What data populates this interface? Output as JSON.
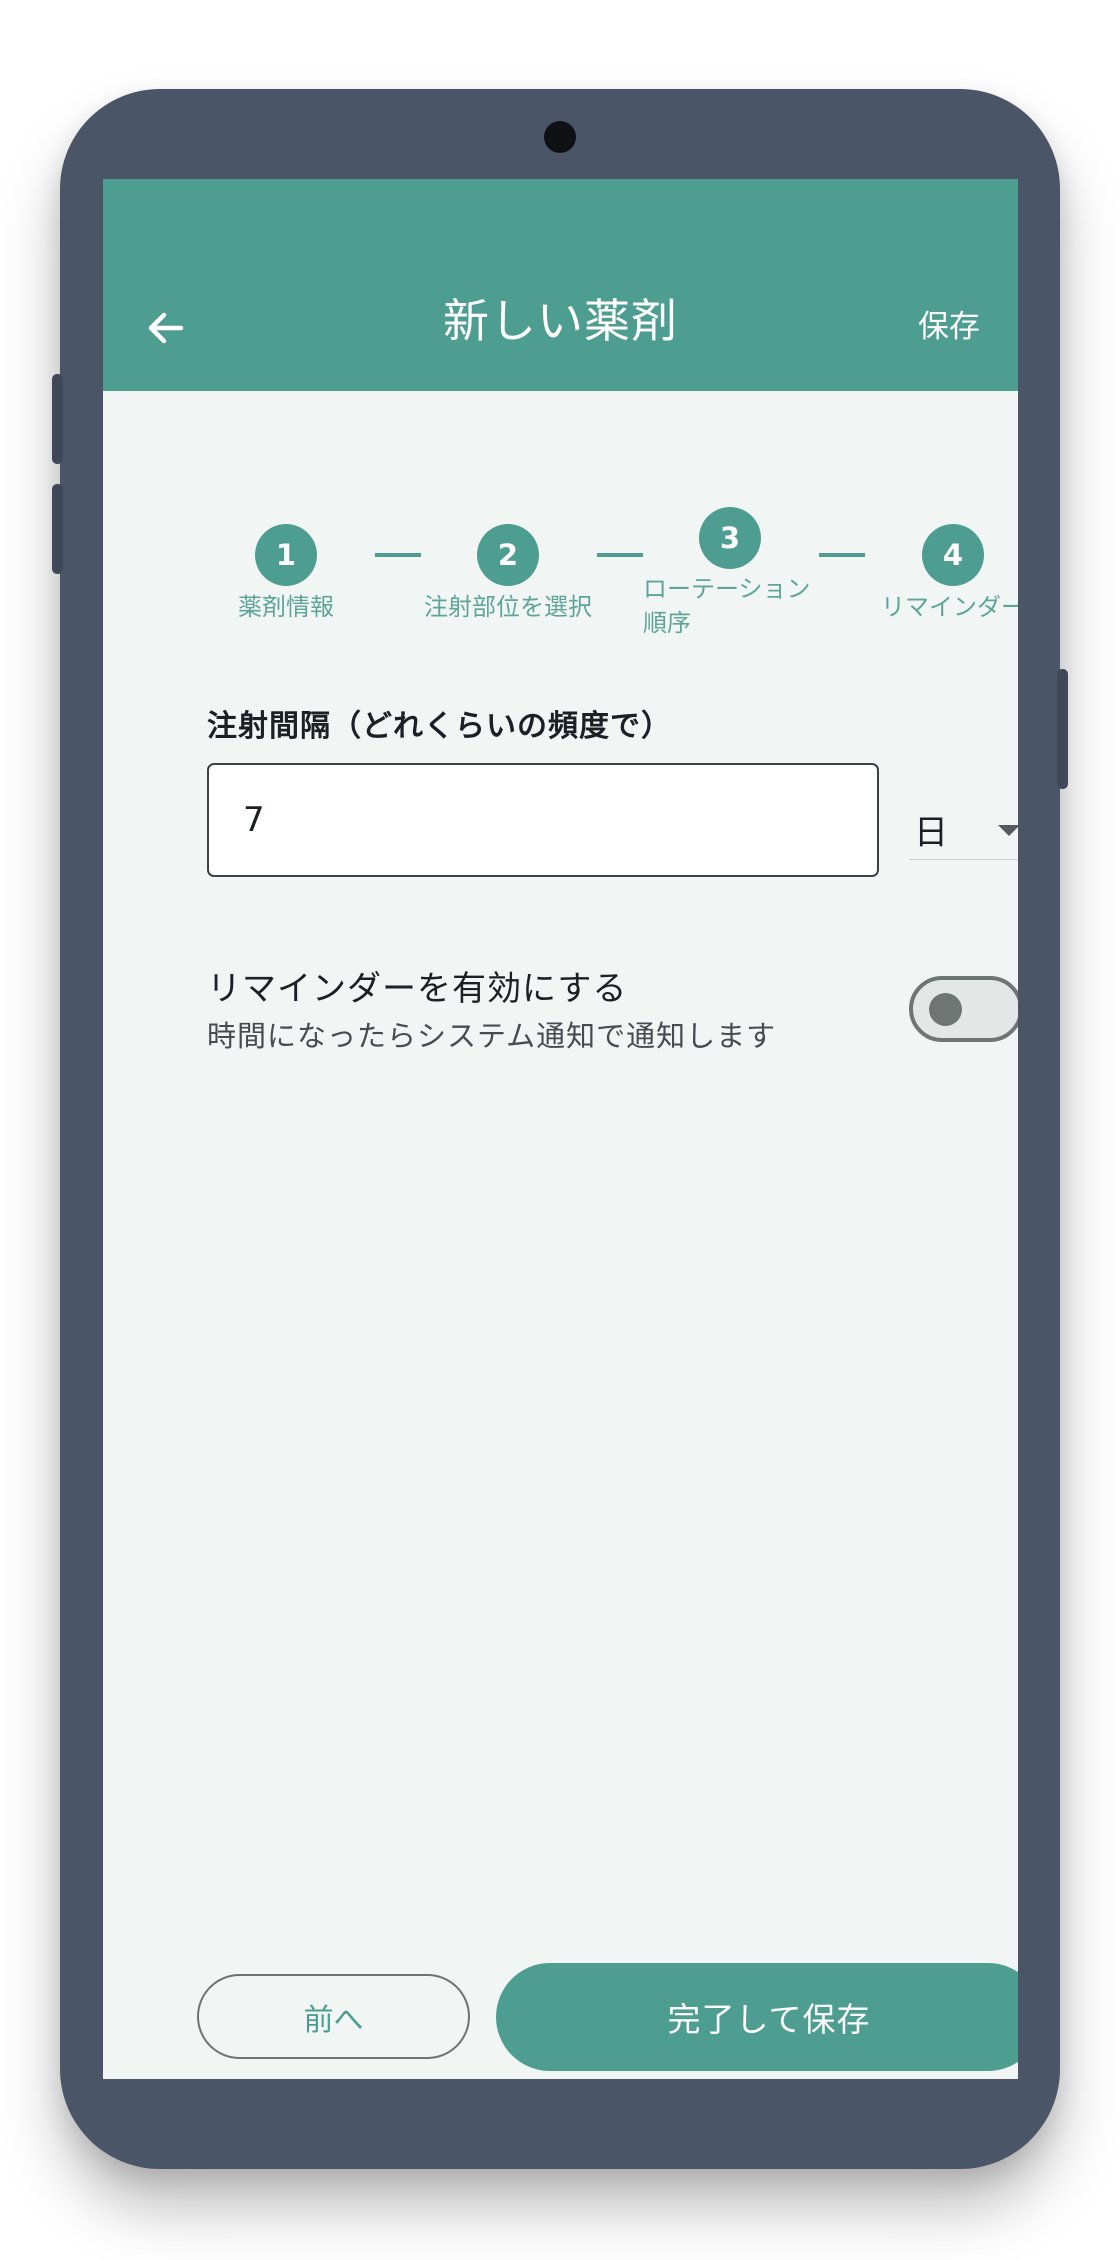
{
  "app_bar": {
    "title": "新しい薬剤",
    "save_label": "保存",
    "back_icon": "arrow-left-icon"
  },
  "steps": [
    {
      "number": "1",
      "label": "薬剤情報"
    },
    {
      "number": "2",
      "label": "注射部位を選択"
    },
    {
      "number": "3",
      "label": "ローテーション順序",
      "label_line1": "ローテーション",
      "label_line2": "順序",
      "active": true
    },
    {
      "number": "4",
      "label": "リマインダー"
    }
  ],
  "interval": {
    "label": "注射間隔（どれくらいの頻度で）",
    "value": "7",
    "unit": "日"
  },
  "reminder": {
    "title": "リマインダーを有効にする",
    "subtitle": "時間になったらシステム通知で通知します",
    "enabled": false
  },
  "footer": {
    "prev_label": "前へ",
    "finish_label": "完了して保存"
  },
  "colors": {
    "primary": "#4d9e90",
    "background": "#f1f6f5",
    "device_frame": "#4a5568"
  }
}
